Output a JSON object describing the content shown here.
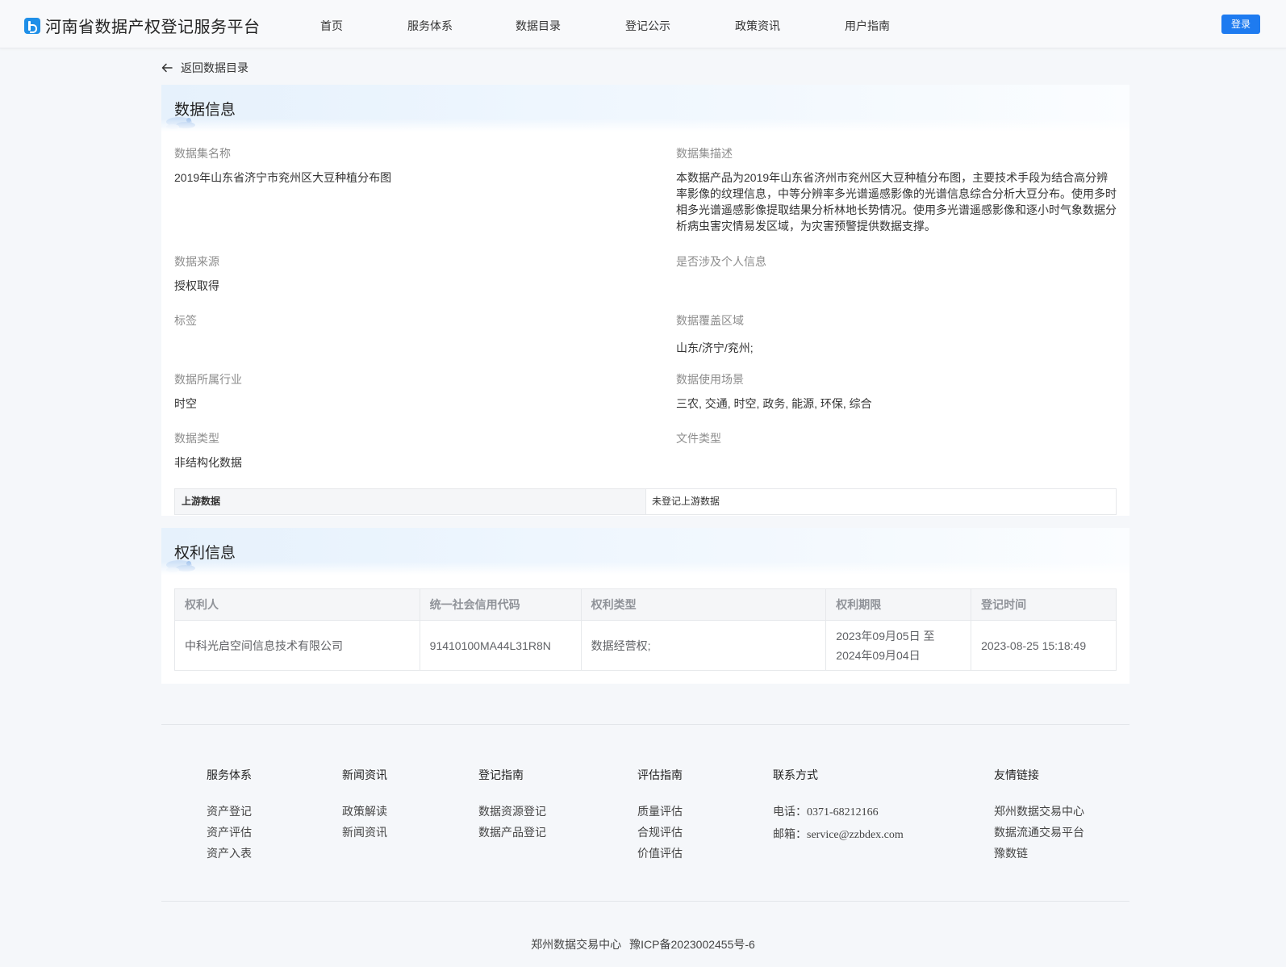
{
  "header": {
    "site_title": "河南省数据产权登记服务平台",
    "nav": [
      "首页",
      "服务体系",
      "数据目录",
      "登记公示",
      "政策资讯",
      "用户指南"
    ],
    "login_label": "登录"
  },
  "back_label": "返回数据目录",
  "data_info": {
    "section_title": "数据信息",
    "fields": {
      "dataset_name": {
        "label": "数据集名称",
        "value": "2019年山东省济宁市兖州区大豆种植分布图"
      },
      "dataset_desc": {
        "label": "数据集描述",
        "value": "本数据产品为2019年山东省济州市兖州区大豆种植分布图，主要技术手段为结合高分辨率影像的纹理信息，中等分辨率多光谱遥感影像的光谱信息综合分析大豆分布。使用多时相多光谱遥感影像提取结果分析林地长势情况。使用多光谱遥感影像和逐小时气象数据分析病虫害灾情易发区域，为灾害预警提供数据支撑。"
      },
      "source": {
        "label": "数据来源",
        "value": "授权取得"
      },
      "personal_info": {
        "label": "是否涉及个人信息",
        "value": ""
      },
      "tags": {
        "label": "标签",
        "value": ""
      },
      "coverage": {
        "label": "数据覆盖区域",
        "value": "山东/济宁/兖州;"
      },
      "industry": {
        "label": "数据所属行业",
        "value": "时空"
      },
      "scenario": {
        "label": "数据使用场景",
        "value": "三农, 交通, 时空, 政务, 能源, 环保, 综合"
      },
      "data_type": {
        "label": "数据类型",
        "value": "非结构化数据"
      },
      "file_type": {
        "label": "文件类型",
        "value": ""
      }
    },
    "upstream": {
      "label": "上游数据",
      "value": "未登记上游数据"
    }
  },
  "rights_info": {
    "section_title": "权利信息",
    "columns": [
      "权利人",
      "统一社会信用代码",
      "权利类型",
      "权利期限",
      "登记时间"
    ],
    "rows": [
      {
        "holder": "中科光启空间信息技术有限公司",
        "credit_code": "91410100MA44L31R8N",
        "right_type": "数据经营权;",
        "period_start": "2023年09月05日 至",
        "period_end": "2024年09月04日",
        "registered_at": "2023-08-25 15:18:49"
      }
    ]
  },
  "footer": {
    "columns": [
      {
        "title": "服务体系",
        "links": [
          "资产登记",
          "资产评估",
          "资产入表"
        ]
      },
      {
        "title": "新闻资讯",
        "links": [
          "政策解读",
          "新闻资讯"
        ]
      },
      {
        "title": "登记指南",
        "links": [
          "数据资源登记",
          "数据产品登记"
        ]
      },
      {
        "title": "评估指南",
        "links": [
          "质量评估",
          "合规评估",
          "价值评估"
        ]
      },
      {
        "title": "联系方式",
        "phone_label": "电话：",
        "phone": "0371-68212166",
        "email_label": "邮箱：",
        "email": "service@zzbdex.com"
      },
      {
        "title": "友情链接",
        "links": [
          "郑州数据交易中心",
          "数据流通交易平台",
          "豫数链"
        ]
      }
    ],
    "org": "郑州数据交易中心",
    "icp": "豫ICP备2023002455号-6"
  }
}
